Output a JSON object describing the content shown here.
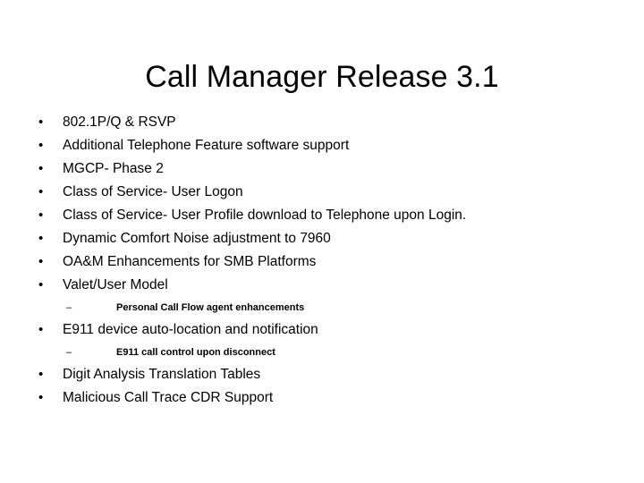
{
  "slide": {
    "title": "Call Manager Release 3.1",
    "background_color": "#FFFFFF",
    "text_color": "#000000",
    "level1_marker": "•",
    "level2_marker": "–",
    "bullets": [
      {
        "level": 1,
        "text": "802.1P/Q & RSVP"
      },
      {
        "level": 1,
        "text": "Additional Telephone Feature software support"
      },
      {
        "level": 1,
        "text": "MGCP- Phase 2"
      },
      {
        "level": 1,
        "text": "Class of Service- User Logon"
      },
      {
        "level": 1,
        "text": "Class of Service- User Profile download to Telephone upon Login."
      },
      {
        "level": 1,
        "text": "Dynamic Comfort Noise adjustment to 7960"
      },
      {
        "level": 1,
        "text": "OA&M Enhancements for SMB Platforms"
      },
      {
        "level": 1,
        "text": "Valet/User Model"
      },
      {
        "level": 2,
        "text": "Personal Call Flow agent enhancements"
      },
      {
        "level": 1,
        "text": "E911 device auto-location and notification"
      },
      {
        "level": 2,
        "text": "E911 call control upon disconnect"
      },
      {
        "level": 1,
        "text": "Digit Analysis Translation Tables"
      },
      {
        "level": 1,
        "text": "Malicious Call Trace CDR Support"
      }
    ]
  }
}
